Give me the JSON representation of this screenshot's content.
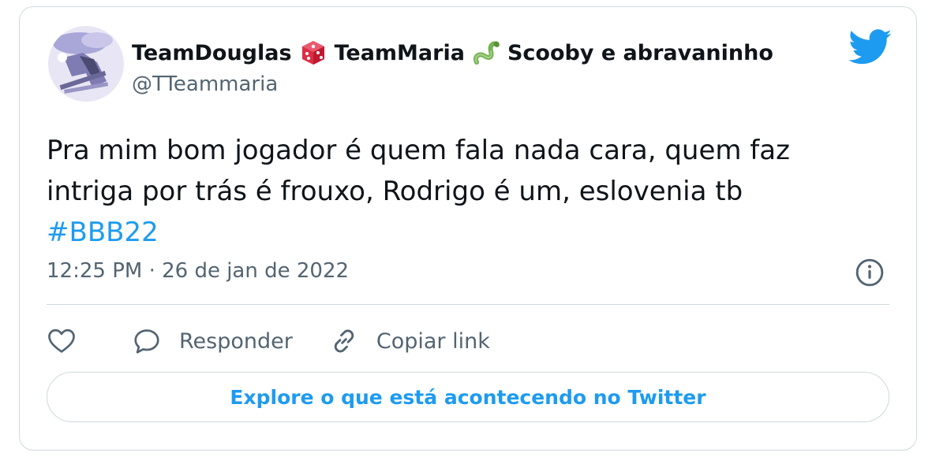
{
  "user": {
    "name_part1": "TeamDouglas",
    "name_part2": "TeamMaria",
    "name_part3": "Scooby e abravaninho",
    "handle": "@TTeammaria",
    "emoji1": "dice-emoji",
    "emoji2": "snake-emoji",
    "avatar": "avatar-image"
  },
  "tweet": {
    "line1": "Pra mim bom jogador é quem fala nada cara, quem faz",
    "line2": "intriga por trás é frouxo, Rodrigo é um, eslovenia tb",
    "hashtag": "#BBB22",
    "timestamp": "12:25 PM · 26 de jan de 2022"
  },
  "actions": {
    "like_icon": "heart-icon",
    "reply_label": "Responder",
    "copy_label": "Copiar link"
  },
  "explore_label": "Explore o que está acontecendo no Twitter",
  "colors": {
    "accent": "#1d9bf0",
    "text": "#0f1419",
    "secondary": "#536471",
    "border": "#cfd9de"
  }
}
